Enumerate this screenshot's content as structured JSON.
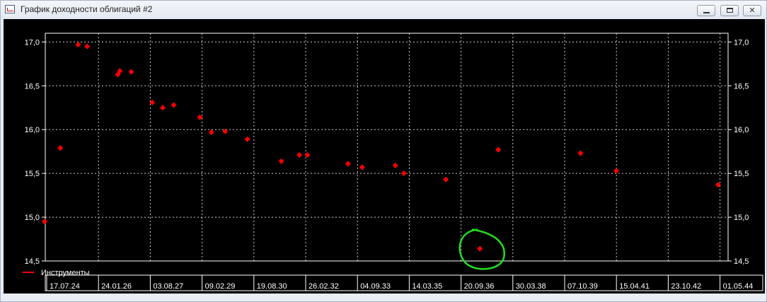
{
  "window": {
    "title": "График доходности облигаций #2"
  },
  "colors": {
    "background": "#000000",
    "grid": "#ffffff",
    "axis": "#ffffff",
    "points": "#ff0000",
    "highlight": "#22dd22",
    "text": "#ffffff"
  },
  "chart_data": {
    "type": "scatter",
    "title": "",
    "xlabel": "",
    "ylabel": "",
    "grid": true,
    "legend_position": "bottom-left",
    "x_tick_labels": [
      "17.07.24",
      "24.01.26",
      "03.08.27",
      "09.02.29",
      "19.08.30",
      "26.02.32",
      "04.09.33",
      "14.03.35",
      "20.09.36",
      "30.03.38",
      "07.10.39",
      "15.04.41",
      "23.10.42",
      "01.05.44"
    ],
    "y_tick_labels": [
      "17,0",
      "16,5",
      "16,0",
      "15,5",
      "15,0",
      "14,5"
    ],
    "y_ticks": [
      17.0,
      16.5,
      16.0,
      15.5,
      15.0,
      14.5
    ],
    "ylim": [
      14.5,
      17.1
    ],
    "xlim": [
      "2024-07-17",
      "2044-05-01"
    ],
    "series": [
      {
        "name": "Инструменты",
        "color": "#ff0000",
        "points": [
          {
            "x": "2024-06-25",
            "y": 14.95
          },
          {
            "x": "2024-12-10",
            "y": 15.79
          },
          {
            "x": "2025-06-20",
            "y": 16.97
          },
          {
            "x": "2025-09-25",
            "y": 16.95
          },
          {
            "x": "2026-08-20",
            "y": 16.63
          },
          {
            "x": "2026-09-10",
            "y": 16.67
          },
          {
            "x": "2027-01-10",
            "y": 16.66
          },
          {
            "x": "2027-08-25",
            "y": 16.31
          },
          {
            "x": "2027-12-15",
            "y": 16.25
          },
          {
            "x": "2028-04-10",
            "y": 16.28
          },
          {
            "x": "2029-01-15",
            "y": 16.14
          },
          {
            "x": "2029-05-20",
            "y": 15.97
          },
          {
            "x": "2029-10-15",
            "y": 15.98
          },
          {
            "x": "2030-06-10",
            "y": 15.89
          },
          {
            "x": "2031-06-10",
            "y": 15.64
          },
          {
            "x": "2031-12-20",
            "y": 15.71
          },
          {
            "x": "2032-03-15",
            "y": 15.71
          },
          {
            "x": "2033-05-25",
            "y": 15.61
          },
          {
            "x": "2033-10-25",
            "y": 15.57
          },
          {
            "x": "2034-10-15",
            "y": 15.59
          },
          {
            "x": "2035-01-15",
            "y": 15.5
          },
          {
            "x": "2036-04-10",
            "y": 15.43
          },
          {
            "x": "2037-04-10",
            "y": 14.64
          },
          {
            "x": "2037-10-25",
            "y": 15.77
          },
          {
            "x": "2040-03-25",
            "y": 15.73
          },
          {
            "x": "2041-04-15",
            "y": 15.53
          },
          {
            "x": "2044-04-10",
            "y": 15.37
          }
        ]
      }
    ],
    "annotations": [
      {
        "type": "circle",
        "color": "#22dd22",
        "x": "2037-04-10",
        "y": 14.64
      }
    ]
  }
}
